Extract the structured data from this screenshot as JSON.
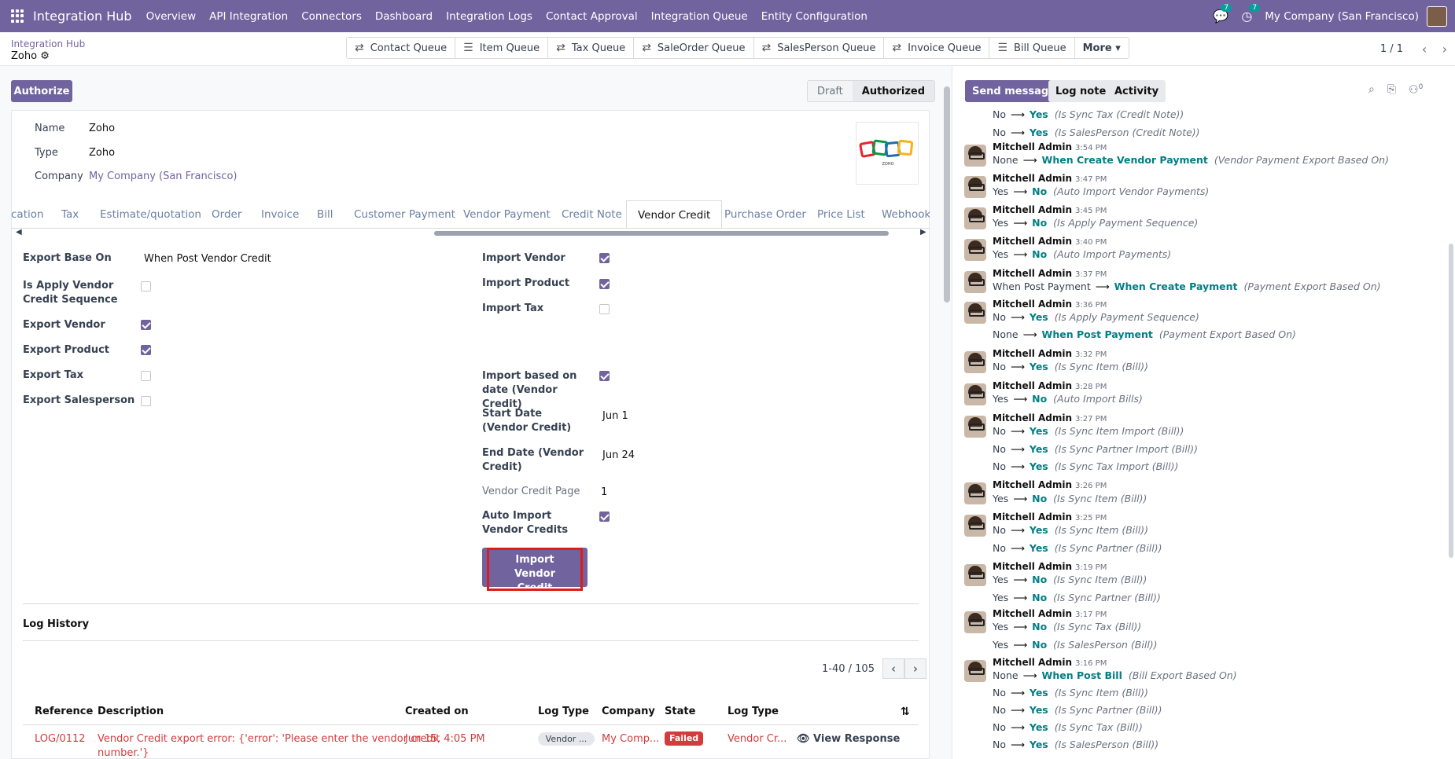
{
  "app": {
    "title": "Integration Hub",
    "company": "My Company (San Francisco)",
    "msg_badge": "7",
    "activity_badge": "7"
  },
  "menu": [
    "Overview",
    "API Integration",
    "Connectors",
    "Dashboard",
    "Integration Logs",
    "Contact Approval",
    "Integration Queue",
    "Entity Configuration"
  ],
  "breadcrumb": {
    "parent": "Integration Hub",
    "current": "Zoho"
  },
  "queues": [
    "Contact Queue",
    "Item Queue",
    "Tax Queue",
    "SaleOrder Queue",
    "SalesPerson Queue",
    "Invoice Queue",
    "Bill Queue"
  ],
  "more_label": "More",
  "pager": {
    "text": "1 / 1"
  },
  "authorize_label": "Authorize",
  "status": {
    "draft": "Draft",
    "authorized": "Authorized"
  },
  "record": {
    "name_label": "Name",
    "name": "Zoho",
    "type_label": "Type",
    "type": "Zoho",
    "company_label": "Company",
    "company": "My Company (San Francisco)",
    "logo_text": "ZOHO"
  },
  "tabs": [
    "cation",
    "Tax",
    "Estimate/quotation",
    "Order",
    "Invoice",
    "Bill",
    "Customer Payment",
    "Vendor Payment",
    "Credit Note",
    "Vendor Credit",
    "Purchase Order",
    "Price List",
    "Webhooks"
  ],
  "active_tab": "Vendor Credit",
  "left_fields": {
    "export_base_on_label": "Export Base On",
    "export_base_on": "When Post Vendor Credit",
    "apply_seq_label": "Is Apply Vendor Credit Sequence",
    "apply_seq": false,
    "export_vendor_label": "Export Vendor",
    "export_vendor": true,
    "export_product_label": "Export Product",
    "export_product": true,
    "export_tax_label": "Export Tax",
    "export_tax": false,
    "export_salesperson_label": "Export Salesperson",
    "export_salesperson": false
  },
  "right_fields": {
    "import_vendor_label": "Import Vendor",
    "import_vendor": true,
    "import_product_label": "Import Product",
    "import_product": true,
    "import_tax_label": "Import Tax",
    "import_tax": false,
    "import_by_date_label": "Import based on date (Vendor Credit)",
    "import_by_date": true,
    "start_date_label": "Start Date (Vendor Credit)",
    "start_date": "Jun 1",
    "end_date_label": "End Date (Vendor Credit)",
    "end_date": "Jun 24",
    "page_label": "Vendor Credit Page",
    "page": "1",
    "auto_import_label": "Auto Import Vendor Credits",
    "auto_import": true
  },
  "import_button": "Import Vendor Credit",
  "log": {
    "title": "Log History",
    "pager": "1-40 / 105",
    "headers": [
      "Reference",
      "Description",
      "Created on",
      "Log Type",
      "Company",
      "State",
      "Log Type"
    ],
    "row": {
      "reference": "LOG/0112",
      "description_1": "Vendor Credit export error: {'error': 'Please enter the vendor credit",
      "description_2": "number.'}",
      "created": "Jun 15, 4:05 PM",
      "log_type": "Vendor ...",
      "company": "My Comp...",
      "state": "Failed",
      "log_type2": "Vendor Cr...",
      "action": "View Response"
    }
  },
  "chatter": {
    "send_message": "Send message",
    "log_note": "Log note",
    "activity": "Activity",
    "follower_count": "0",
    "author": "Mitchell Admin",
    "entries": [
      {
        "time": null,
        "changes": [
          {
            "old": "No",
            "new": "Yes",
            "field": "(Is Sync Tax (Credit Note))"
          },
          {
            "old": "No",
            "new": "Yes",
            "field": "(Is SalesPerson (Credit Note))"
          }
        ]
      },
      {
        "time": "3:54 PM",
        "changes": [
          {
            "old": "None",
            "new": "When Create Vendor Payment",
            "field": "(Vendor Payment Export Based On)"
          }
        ]
      },
      {
        "time": "3:47 PM",
        "changes": [
          {
            "old": "Yes",
            "new": "No",
            "field": "(Auto Import Vendor Payments)"
          }
        ]
      },
      {
        "time": "3:45 PM",
        "changes": [
          {
            "old": "Yes",
            "new": "No",
            "field": "(Is Apply Payment Sequence)"
          }
        ]
      },
      {
        "time": "3:40 PM",
        "changes": [
          {
            "old": "Yes",
            "new": "No",
            "field": "(Auto Import Payments)"
          }
        ]
      },
      {
        "time": "3:37 PM",
        "changes": [
          {
            "old": "When Post Payment",
            "new": "When Create Payment",
            "field": "(Payment Export Based On)"
          }
        ]
      },
      {
        "time": "3:36 PM",
        "changes": [
          {
            "old": "No",
            "new": "Yes",
            "field": "(Is Apply Payment Sequence)"
          },
          {
            "old": "None",
            "new": "When Post Payment",
            "field": "(Payment Export Based On)"
          }
        ]
      },
      {
        "time": "3:32 PM",
        "changes": [
          {
            "old": "No",
            "new": "Yes",
            "field": "(Is Sync Item (Bill))"
          }
        ]
      },
      {
        "time": "3:28 PM",
        "changes": [
          {
            "old": "Yes",
            "new": "No",
            "field": "(Auto Import Bills)"
          }
        ]
      },
      {
        "time": "3:27 PM",
        "changes": [
          {
            "old": "No",
            "new": "Yes",
            "field": "(Is Sync Item Import (Bill))"
          },
          {
            "old": "No",
            "new": "Yes",
            "field": "(Is Sync Partner Import (Bill))"
          },
          {
            "old": "No",
            "new": "Yes",
            "field": "(Is Sync Tax Import (Bill))"
          }
        ]
      },
      {
        "time": "3:26 PM",
        "changes": [
          {
            "old": "Yes",
            "new": "No",
            "field": "(Is Sync Item (Bill))"
          }
        ]
      },
      {
        "time": "3:25 PM",
        "changes": [
          {
            "old": "No",
            "new": "Yes",
            "field": "(Is Sync Item (Bill))"
          },
          {
            "old": "No",
            "new": "Yes",
            "field": "(Is Sync Partner (Bill))"
          }
        ]
      },
      {
        "time": "3:19 PM",
        "changes": [
          {
            "old": "Yes",
            "new": "No",
            "field": "(Is Sync Item (Bill))"
          },
          {
            "old": "Yes",
            "new": "No",
            "field": "(Is Sync Partner (Bill))"
          }
        ]
      },
      {
        "time": "3:17 PM",
        "changes": [
          {
            "old": "Yes",
            "new": "No",
            "field": "(Is Sync Tax (Bill))"
          },
          {
            "old": "Yes",
            "new": "No",
            "field": "(Is SalesPerson (Bill))"
          }
        ]
      },
      {
        "time": "3:16 PM",
        "changes": [
          {
            "old": "None",
            "new": "When Post Bill",
            "field": "(Bill Export Based On)"
          },
          {
            "old": "No",
            "new": "Yes",
            "field": "(Is Sync Item (Bill))"
          },
          {
            "old": "No",
            "new": "Yes",
            "field": "(Is Sync Partner (Bill))"
          },
          {
            "old": "No",
            "new": "Yes",
            "field": "(Is Sync Tax (Bill))"
          },
          {
            "old": "No",
            "new": "Yes",
            "field": "(Is SalesPerson (Bill))"
          }
        ]
      }
    ]
  }
}
